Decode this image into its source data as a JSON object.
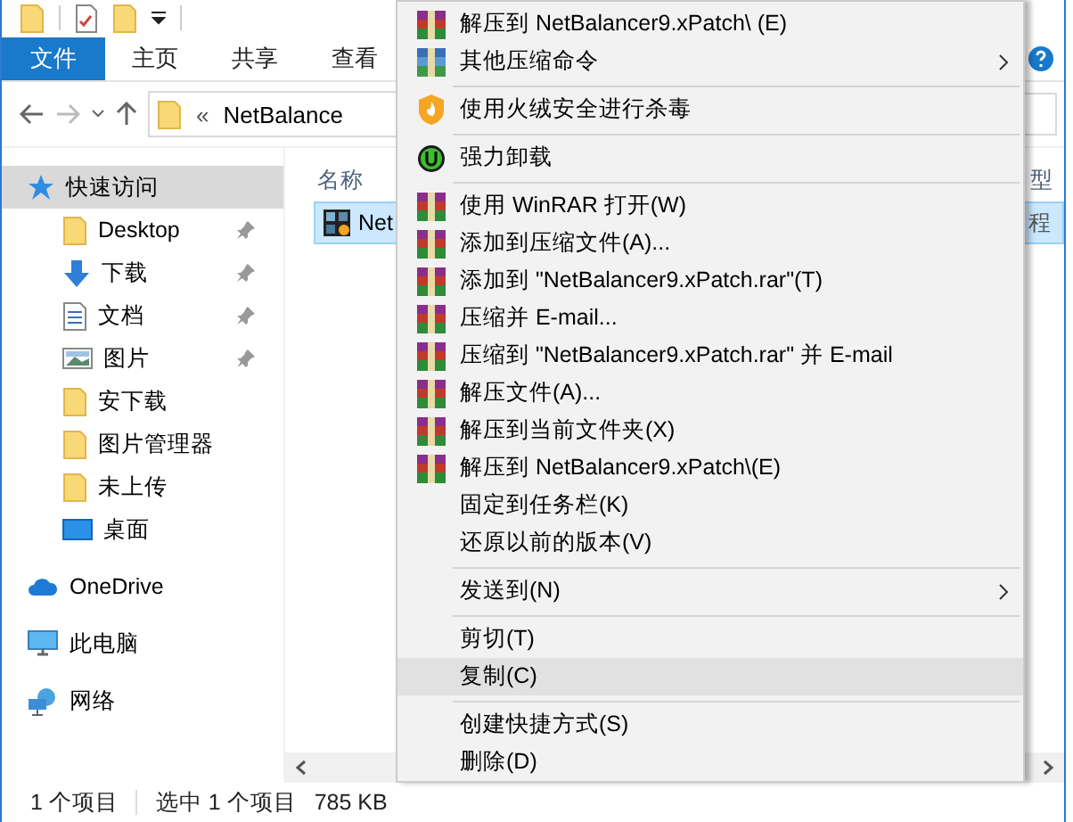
{
  "ribbon_tabs": [
    {
      "label": "文件",
      "selected": true
    },
    {
      "label": "主页",
      "selected": false
    },
    {
      "label": "共享",
      "selected": false
    },
    {
      "label": "查看",
      "selected": false
    }
  ],
  "address_bar": {
    "chevron": "«",
    "path": "NetBalance"
  },
  "navigation_pane": [
    {
      "label": "快速访问",
      "kind": "quick",
      "selected": true,
      "children": [
        {
          "label": "Desktop",
          "kind": "folder",
          "pinned": true,
          "selected": false
        },
        {
          "label": "下载",
          "kind": "download",
          "pinned": true,
          "selected": false
        },
        {
          "label": "文档",
          "kind": "document",
          "pinned": true,
          "selected": false
        },
        {
          "label": "图片",
          "kind": "pictures",
          "pinned": true,
          "selected": false
        },
        {
          "label": "安下载",
          "kind": "folder",
          "pinned": false,
          "selected": false
        },
        {
          "label": "图片管理器",
          "kind": "folder",
          "pinned": false,
          "selected": false
        },
        {
          "label": "未上传",
          "kind": "folder",
          "pinned": false,
          "selected": false
        },
        {
          "label": "桌面",
          "kind": "desktop",
          "pinned": false,
          "selected": false
        }
      ]
    },
    {
      "label": "OneDrive",
      "kind": "cloud",
      "selected": false
    },
    {
      "label": "此电脑",
      "kind": "pc",
      "selected": false
    },
    {
      "label": "网络",
      "kind": "network",
      "selected": false
    }
  ],
  "file_list": {
    "columns": [
      "名称",
      "型"
    ],
    "rows": [
      {
        "name": "Net",
        "column_2": "程",
        "selected": true
      }
    ]
  },
  "status_bar": {
    "count": "1 个项目",
    "selection": "选中 1 个项目",
    "size": "785 KB"
  },
  "context_menu": [
    {
      "kind": "winrar",
      "label": "解压到 NetBalancer9.xPatch\\ (E)",
      "submenu": false,
      "selected": false
    },
    {
      "kind": "archive",
      "label": "其他压缩命令",
      "submenu": true,
      "selected": false
    },
    {
      "kind": "separator"
    },
    {
      "kind": "shield",
      "label": "使用火绒安全进行杀毒",
      "submenu": false,
      "selected": false
    },
    {
      "kind": "separator"
    },
    {
      "kind": "uninstall",
      "label": "强力卸载",
      "submenu": false,
      "selected": false
    },
    {
      "kind": "separator"
    },
    {
      "kind": "winrar",
      "label": "使用 WinRAR 打开(W)",
      "submenu": false,
      "selected": false
    },
    {
      "kind": "winrar",
      "label": "添加到压缩文件(A)...",
      "submenu": false,
      "selected": false
    },
    {
      "kind": "winrar",
      "label": "添加到 \"NetBalancer9.xPatch.rar\"(T)",
      "submenu": false,
      "selected": false
    },
    {
      "kind": "winrar",
      "label": "压缩并 E-mail...",
      "submenu": false,
      "selected": false
    },
    {
      "kind": "winrar",
      "label": "压缩到 \"NetBalancer9.xPatch.rar\" 并 E-mail",
      "submenu": false,
      "selected": false
    },
    {
      "kind": "winrar",
      "label": "解压文件(A)...",
      "submenu": false,
      "selected": false
    },
    {
      "kind": "winrar",
      "label": "解压到当前文件夹(X)",
      "submenu": false,
      "selected": false
    },
    {
      "kind": "winrar",
      "label": "解压到 NetBalancer9.xPatch\\(E)",
      "submenu": false,
      "selected": false
    },
    {
      "kind": "plain",
      "label": "固定到任务栏(K)",
      "submenu": false,
      "selected": false
    },
    {
      "kind": "plain",
      "label": "还原以前的版本(V)",
      "submenu": false,
      "selected": false
    },
    {
      "kind": "separator"
    },
    {
      "kind": "plain",
      "label": "发送到(N)",
      "submenu": true,
      "selected": false
    },
    {
      "kind": "separator"
    },
    {
      "kind": "plain",
      "label": "剪切(T)",
      "submenu": false,
      "selected": false
    },
    {
      "kind": "plain",
      "label": "复制(C)",
      "submenu": false,
      "selected": true
    },
    {
      "kind": "separator"
    },
    {
      "kind": "plain",
      "label": "创建快捷方式(S)",
      "submenu": false,
      "selected": false
    },
    {
      "kind": "plain",
      "label": "删除(D)",
      "submenu": false,
      "selected": false
    }
  ]
}
